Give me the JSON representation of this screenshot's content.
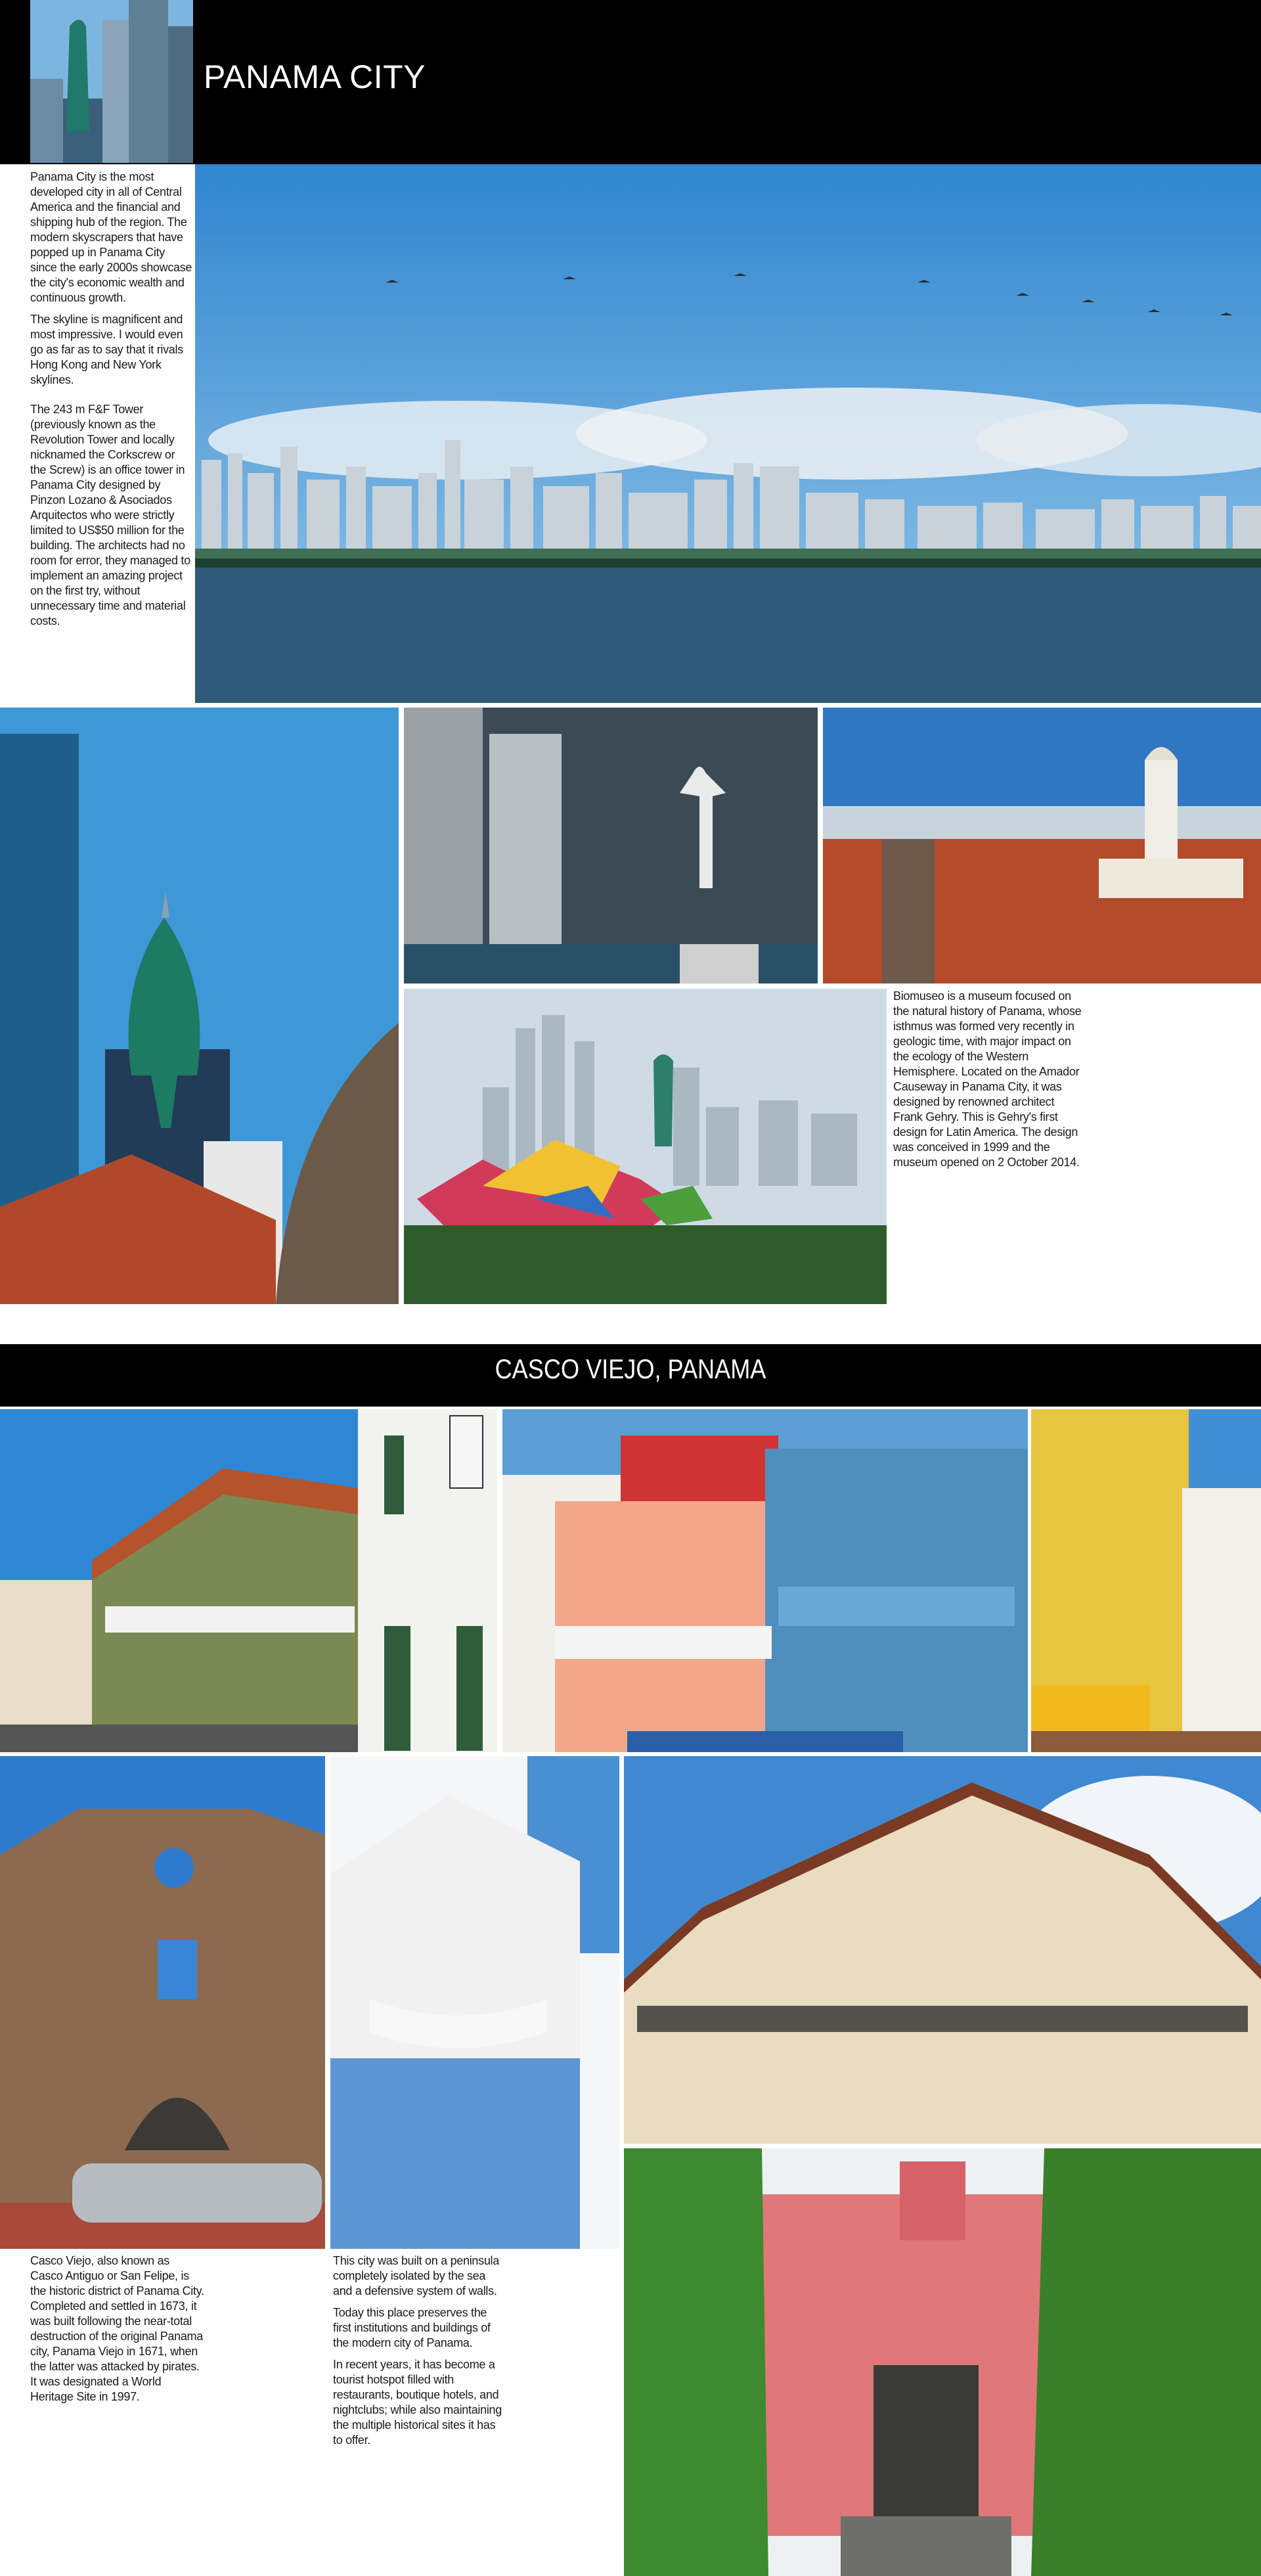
{
  "section1": {
    "title": "PANAMA CITY",
    "intro_p1": "Panama City is the most developed city in all of Central America and the financial and shipping hub of the region. The modern skyscrapers that have popped up in Panama City since the early 2000s showcase the city's economic wealth and continuous growth.",
    "intro_p2": "The skyline is magnificent and most impressive. I would even go as far as to say that it rivals Hong Kong and New York skylines.",
    "tower_text": "The 243 m F&F Tower (previously known as the Revolution Tower and locally nicknamed the Corkscrew or the Screw) is an office tower in Panama City designed by Pinzon Lozano & Asociados Arquitectos who were strictly limited to US$50 million for the building. The architects had no room for error, they managed to implement an amazing project on the first try, without unnecessary time and material costs.",
    "biomuseo_text": "Biomuseo is a museum focused on the natural history of Panama, whose isthmus was formed very recently in geologic time, with major impact on the ecology of the Western Hemisphere. Located on the Amador Causeway in Panama City, it was designed by renowned architect Frank Gehry. This is Gehry's first design for Latin America. The design was conceived in 1999 and the museum opened on 2 October 2014."
  },
  "section2": {
    "title": "CASCO VIEJO, PANAMA",
    "casco_text": "Casco Viejo, also known as Casco Antiguo or San Felipe, is the historic district of Panama City. Completed and settled in 1673, it was built following the near-total destruction of the original Panama city, Panama Viejo in 1671, when the latter was attacked by pirates. It was designated a World Heritage Site in 1997.",
    "peninsula_p1": "This city was built on a peninsula completely isolated by the sea and a defensive system of walls.",
    "peninsula_p2": "Today this place preserves the first institutions and buildings of the modern city of Panama.",
    "peninsula_p3": "In recent years, it has become a tourist hotspot filled with restaurants, boutique hotels, and nightclubs; while also maintaining the multiple historical sites it has to offer."
  },
  "colors": {
    "header_bar": "#000000",
    "sky": "#4f9fd6",
    "sea": "#2f5b78"
  }
}
